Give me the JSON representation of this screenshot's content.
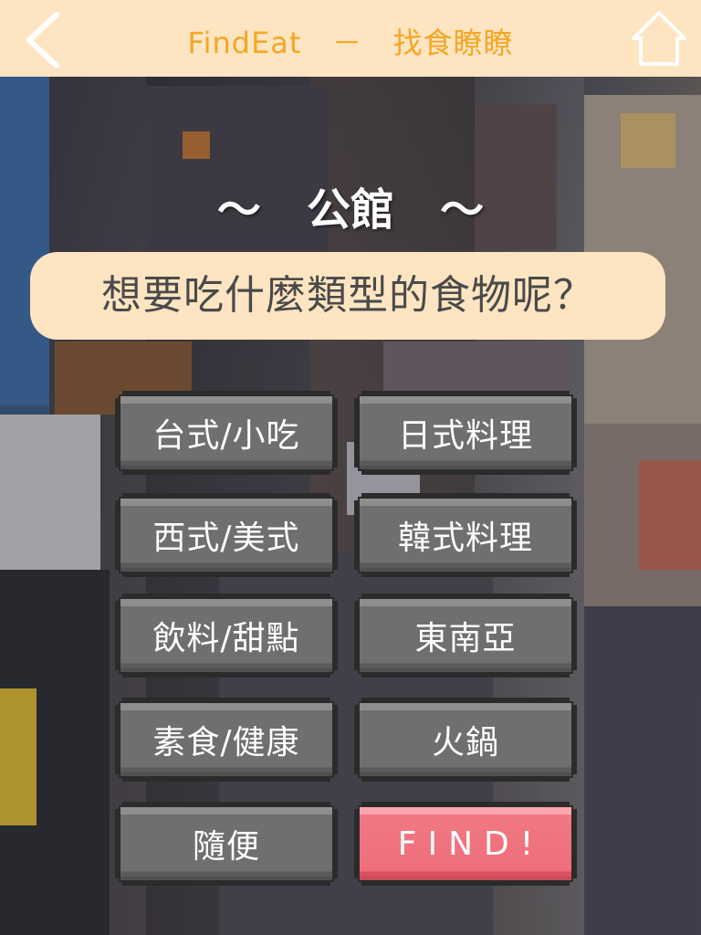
{
  "header": {
    "title": "FindEat   －   找食瞭瞭",
    "back_icon": "chevron-left-icon",
    "home_icon": "home-icon",
    "background_color": "#fde5c2",
    "title_color": "#f5a623"
  },
  "location": {
    "label": "～   公館   ～"
  },
  "question": {
    "text": "想要吃什麼類型的食物呢？"
  },
  "categories": [
    {
      "label": "台式/小吃"
    },
    {
      "label": "日式料理"
    },
    {
      "label": "西式/美式"
    },
    {
      "label": "韓式料理"
    },
    {
      "label": "飲料/甜點"
    },
    {
      "label": "東南亞"
    },
    {
      "label": "素食/健康"
    },
    {
      "label": "火鍋"
    },
    {
      "label": "隨便"
    }
  ],
  "find_button": {
    "label": "FIND!",
    "color": "#ee6e7a"
  },
  "colors": {
    "button_face": "#6f6f6f",
    "button_border": "#2b2b2b",
    "question_bg": "#fde5c2"
  }
}
